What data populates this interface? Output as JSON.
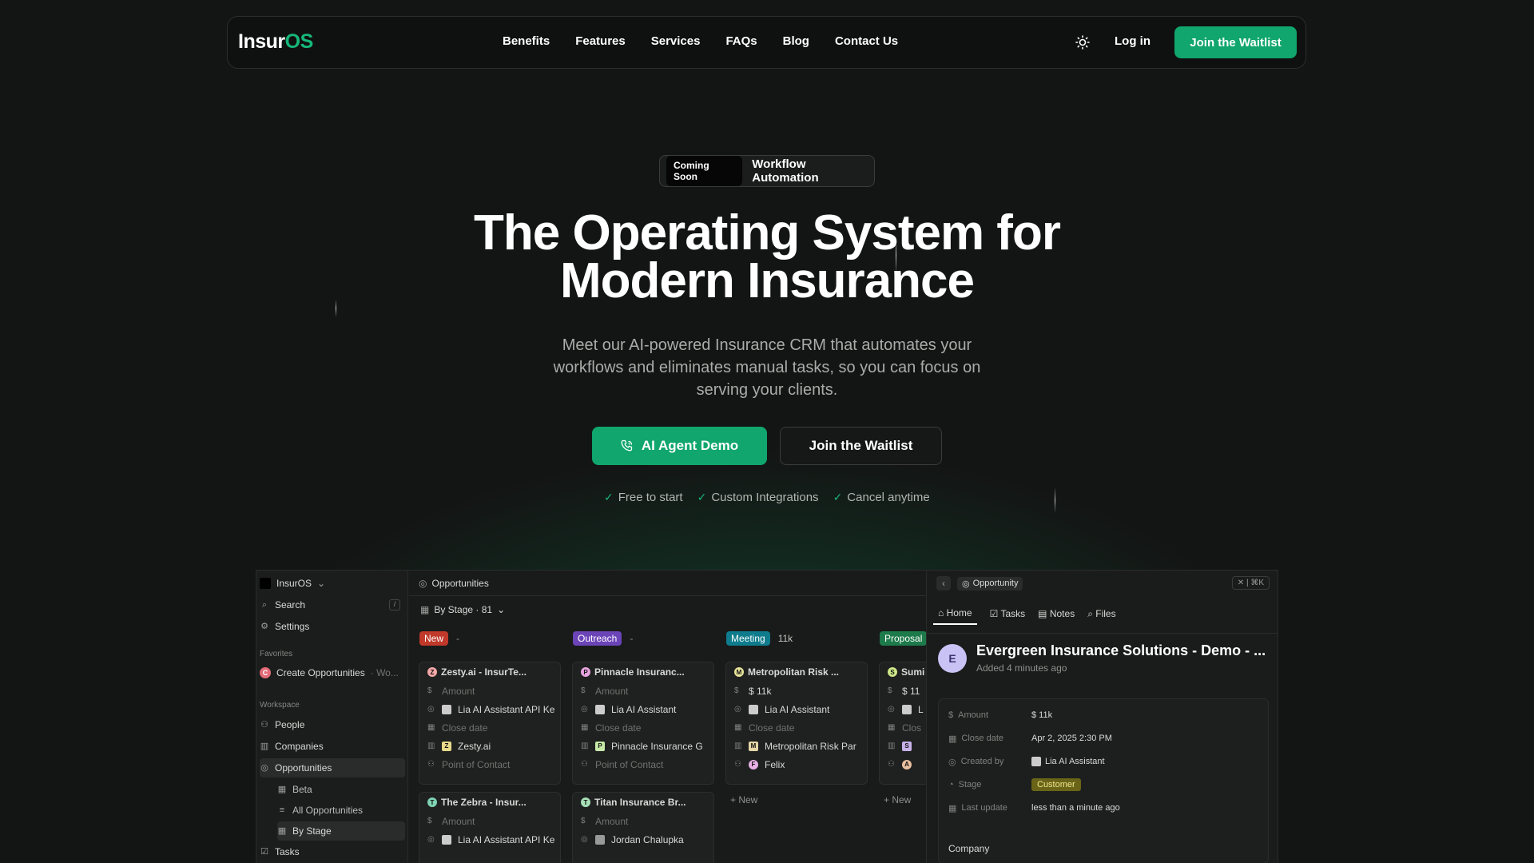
{
  "nav": {
    "logo_main": "Insur",
    "logo_accent": "OS",
    "links": [
      "Benefits",
      "Features",
      "Services",
      "FAQs",
      "Blog",
      "Contact Us"
    ],
    "login": "Log in",
    "cta": "Join the Waitlist"
  },
  "hero": {
    "badge": "Coming Soon",
    "badge_text": "Workflow Automation",
    "title_line1": "The Operating System for",
    "title_line2": "Modern Insurance",
    "subtitle": "Meet our AI-powered Insurance CRM that automates your workflows and eliminates manual tasks, so you can focus on serving your clients.",
    "demo_button": "AI Agent Demo",
    "waitlist_button": "Join the Waitlist",
    "features": [
      "Free to start",
      "Custom Integrations",
      "Cancel anytime"
    ]
  },
  "colors": {
    "accent": "#10a66d",
    "background": "#131514"
  },
  "app": {
    "workspace_name": "InsurOS",
    "sidebar": {
      "search": "Search",
      "search_shortcut": "/",
      "settings": "Settings",
      "favorites_label": "Favorites",
      "favorite_item": "Create Opportunities",
      "favorite_item_suffix": "· Wo...",
      "favorite_badge": "C",
      "workspace_label": "Workspace",
      "people": "People",
      "companies": "Companies",
      "opportunities": "Opportunities",
      "beta": "Beta",
      "all_opportunities": "All Opportunities",
      "by_stage": "By Stage",
      "tasks": "Tasks"
    },
    "main_title": "Opportunities",
    "view_label": "By Stage · 81",
    "columns": [
      {
        "tag": "New",
        "meta": "-",
        "color": "#c0392b"
      },
      {
        "tag": "Outreach",
        "meta": "-",
        "color": "#6b44b8"
      },
      {
        "tag": "Meeting",
        "meta": "11k",
        "color": "#0e7c8c"
      },
      {
        "tag": "Proposal",
        "meta": "",
        "color": "#1d7a4a"
      }
    ],
    "cards": {
      "c1": {
        "title": "Zesty.ai - InsurTe...",
        "amount": "Amount",
        "owner": "Lia AI Assistant API Ke",
        "close": "Close date",
        "company": "Zesty.ai",
        "contact": "Point of Contact",
        "dot": "Z"
      },
      "c2": {
        "title": "The Zebra - Insur...",
        "amount": "Amount",
        "owner": "Lia AI Assistant API Ke",
        "dot": "T"
      },
      "c3": {
        "title": "Pinnacle Insuranc...",
        "amount": "Amount",
        "owner": "Lia AI Assistant",
        "close": "Close date",
        "company": "Pinnacle Insurance G",
        "contact": "Point of Contact",
        "dot": "P"
      },
      "c4": {
        "title": "Titan Insurance Br...",
        "amount": "Amount",
        "owner": "Jordan Chalupka",
        "dot": "T"
      },
      "c5": {
        "title": "Metropolitan Risk ...",
        "amount": "$ 11k",
        "owner": "Lia AI Assistant",
        "close": "Close date",
        "company": "Metropolitan Risk Par",
        "contact": "Felix",
        "dot": "M"
      },
      "c6": {
        "title": "Sumi",
        "amount": "$ 11",
        "owner": "L",
        "close": "Clos",
        "company": "S",
        "contact": "A",
        "dot": "S"
      }
    },
    "new_label": "+ New",
    "detail": {
      "chip": "Opportunity",
      "close_hint": "✕ | ⌘K",
      "tabs": [
        "Home",
        "Tasks",
        "Notes",
        "Files"
      ],
      "avatar": "E",
      "name": "Evergreen Insurance Solutions - Demo - ...",
      "added": "Added 4 minutes ago",
      "props": {
        "amount_k": "Amount",
        "amount_v": "$ 11k",
        "close_k": "Close date",
        "close_v": "Apr 2, 2025 2:30 PM",
        "created_k": "Created by",
        "created_v": "Lia AI Assistant",
        "stage_k": "Stage",
        "stage_v": "Customer",
        "update_k": "Last update",
        "update_v": "less than a minute ago"
      },
      "company_label": "Company"
    }
  }
}
